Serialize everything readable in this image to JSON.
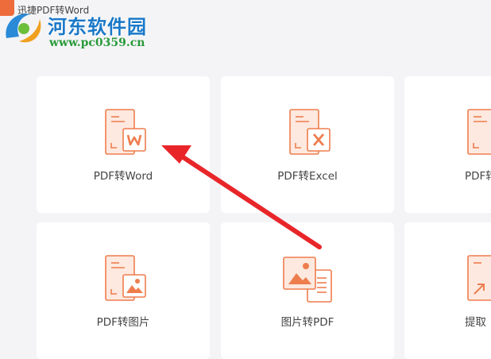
{
  "window": {
    "title": "迅捷PDF转Word"
  },
  "watermark": {
    "site_name": "河东软件园",
    "url": "www.pc0359.cn"
  },
  "accent_color": "#ee7d4e",
  "annotation_color": "#e8262a",
  "tools": [
    {
      "label": "PDF转Word",
      "icon": "pdf-to-word-icon"
    },
    {
      "label": "PDF转Excel",
      "icon": "pdf-to-excel-icon"
    },
    {
      "label": "PDF转",
      "icon": "pdf-to-ppt-icon"
    },
    {
      "label": "PDF转图片",
      "icon": "pdf-to-image-icon"
    },
    {
      "label": "图片转PDF",
      "icon": "image-to-pdf-icon"
    },
    {
      "label": "提取",
      "icon": "extract-icon"
    }
  ]
}
